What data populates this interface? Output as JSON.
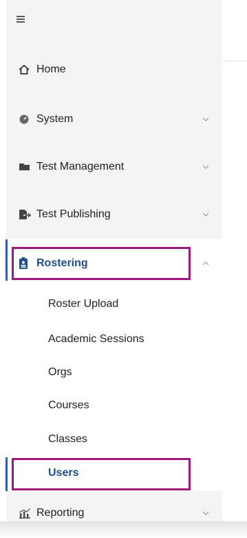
{
  "menu": {
    "toggle_icon": "hamburger-icon"
  },
  "nav": {
    "items": [
      {
        "label": "Home",
        "icon": "home-icon"
      },
      {
        "label": "System",
        "icon": "gauge-icon",
        "expandable": true
      },
      {
        "label": "Test Management",
        "icon": "folder-icon",
        "expandable": true
      },
      {
        "label": "Test Publishing",
        "icon": "publish-icon",
        "expandable": true
      },
      {
        "label": "Rostering",
        "icon": "badge-icon",
        "expandable": true,
        "expanded": true
      },
      {
        "label": "Reporting",
        "icon": "chart-icon",
        "expandable": true
      }
    ],
    "rostering_children": [
      {
        "label": "Roster Upload"
      },
      {
        "label": "Academic Sessions"
      },
      {
        "label": "Orgs"
      },
      {
        "label": "Courses"
      },
      {
        "label": "Classes"
      },
      {
        "label": "Users",
        "active": true
      }
    ]
  },
  "colors": {
    "active_text": "#1d4e89",
    "highlight": "#a0167a",
    "sidebar_bg": "#f4f4f5"
  }
}
